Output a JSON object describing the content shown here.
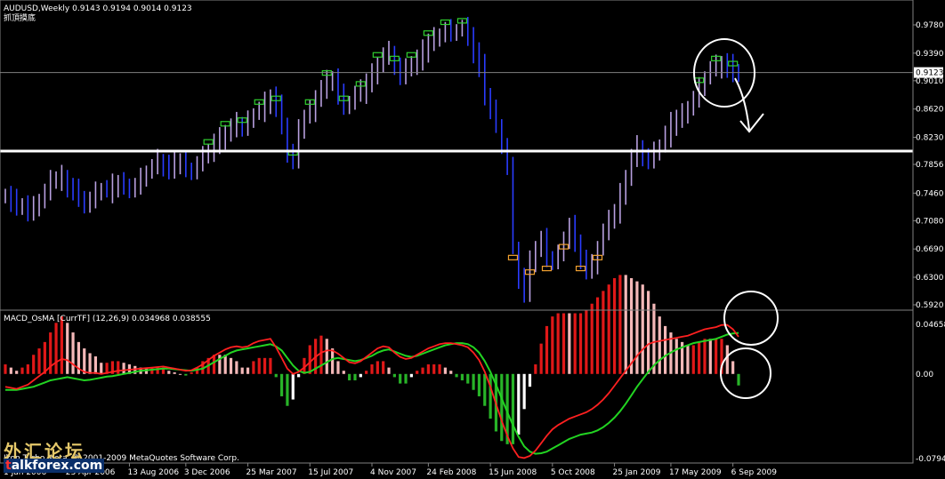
{
  "header": {
    "symbol_line": "AUDUSD,Weekly  0.9143 0.9194 0.9014 0.9123",
    "subtitle": "抓頂摸底"
  },
  "indicator": {
    "label": "MACD_OsMA [CurrTF] (12,26,9) 0.034968 0.038555"
  },
  "footer": {
    "copyright": "Ikon Turbo Meta, © 2001-2009 MetaQuotes Software Corp."
  },
  "watermark": {
    "line1": "外汇论坛",
    "line2_prefix": "t",
    "line2_rest": "alkforex.com"
  },
  "colors": {
    "background": "#000000",
    "grid": "#808080",
    "bull_candle": "#b8a0e0",
    "bear_candle": "#2a3cff",
    "support_line": "#ffffff",
    "macd_line": "#ff2020",
    "signal_line": "#22d422",
    "hist_pos_strong": "#e01818",
    "hist_pos_weak": "#f4b8b8",
    "hist_neg_strong": "#28b428",
    "hist_neg_weak": "#ffffff",
    "marker_buy": "#f0a030",
    "marker_sell": "#30d030",
    "current_price_box": "#ffffff"
  },
  "chart_data": [
    {
      "type": "candlestick",
      "timeframe": "Weekly",
      "ylim": [
        0.592,
        0.978
      ],
      "y_ticks": [
        "0.9780",
        "0.9390",
        "0.9010",
        "0.8620",
        "0.8230",
        "0.7856",
        "0.7460",
        "0.7080",
        "0.6690",
        "0.6300",
        "0.5920"
      ],
      "current_price": "0.9123",
      "support_level": 0.804,
      "x_tick_labels": [
        "1 Jan 2006",
        "23 Apr 2006",
        "13 Aug 2006",
        "3 Dec 2006",
        "25 Mar 2007",
        "15 Jul 2007",
        "4 Nov 2007",
        "24 Feb 2008",
        "15 Jun 2008",
        "5 Oct 2008",
        "25 Jan 2009",
        "17 May 2009",
        "6 Sep 2009"
      ],
      "closes": [
        0.744,
        0.736,
        0.73,
        0.73,
        0.72,
        0.725,
        0.735,
        0.745,
        0.76,
        0.765,
        0.77,
        0.755,
        0.75,
        0.74,
        0.73,
        0.735,
        0.745,
        0.75,
        0.748,
        0.755,
        0.76,
        0.758,
        0.752,
        0.755,
        0.765,
        0.775,
        0.78,
        0.79,
        0.785,
        0.78,
        0.785,
        0.79,
        0.78,
        0.775,
        0.785,
        0.795,
        0.805,
        0.815,
        0.82,
        0.83,
        0.835,
        0.84,
        0.835,
        0.845,
        0.855,
        0.86,
        0.87,
        0.88,
        0.865,
        0.84,
        0.8,
        0.79,
        0.83,
        0.85,
        0.86,
        0.88,
        0.89,
        0.9,
        0.905,
        0.88,
        0.865,
        0.87,
        0.88,
        0.885,
        0.9,
        0.91,
        0.925,
        0.935,
        0.94,
        0.92,
        0.905,
        0.915,
        0.925,
        0.93,
        0.94,
        0.955,
        0.96,
        0.965,
        0.97,
        0.965,
        0.97,
        0.972,
        0.965,
        0.94,
        0.92,
        0.88,
        0.86,
        0.84,
        0.81,
        0.78,
        0.67,
        0.63,
        0.61,
        0.65,
        0.67,
        0.68,
        0.655,
        0.65,
        0.66,
        0.685,
        0.7,
        0.68,
        0.655,
        0.64,
        0.645,
        0.67,
        0.69,
        0.705,
        0.72,
        0.745,
        0.77,
        0.795,
        0.81,
        0.795,
        0.79,
        0.8,
        0.81,
        0.825,
        0.84,
        0.85,
        0.855,
        0.865,
        0.875,
        0.89,
        0.905,
        0.915,
        0.92,
        0.925,
        0.92,
        0.913,
        0.9123
      ]
    },
    {
      "type": "histogram_with_lines",
      "name": "MACD_OsMA [CurrTF] (12,26,9)",
      "ylim": [
        -0.07948,
        0.04658
      ],
      "y_ticks": [
        "0.04658",
        "0.00",
        "-0.07948"
      ],
      "macd_value": 0.034968,
      "signal_value": 0.038555,
      "signal_line": [
        -0.015,
        -0.015,
        -0.015,
        -0.014,
        -0.013,
        -0.012,
        -0.01,
        -0.008,
        -0.006,
        -0.005,
        -0.004,
        -0.003,
        -0.004,
        -0.005,
        -0.006,
        -0.0055,
        -0.0045,
        -0.0035,
        -0.0025,
        -0.002,
        -0.001,
        0.0,
        0.001,
        0.002,
        0.003,
        0.0035,
        0.004,
        0.0045,
        0.005,
        0.005,
        0.0045,
        0.004,
        0.0035,
        0.003,
        0.004,
        0.005,
        0.008,
        0.011,
        0.014,
        0.017,
        0.02,
        0.022,
        0.023,
        0.024,
        0.025,
        0.026,
        0.027,
        0.028,
        0.026,
        0.022,
        0.015,
        0.008,
        0.003,
        0.001,
        0.002,
        0.005,
        0.008,
        0.011,
        0.014,
        0.015,
        0.014,
        0.013,
        0.012,
        0.013,
        0.015,
        0.017,
        0.02,
        0.022,
        0.023,
        0.021,
        0.019,
        0.017,
        0.016,
        0.017,
        0.019,
        0.021,
        0.023,
        0.025,
        0.027,
        0.028,
        0.029,
        0.029,
        0.028,
        0.025,
        0.02,
        0.012,
        0.002,
        -0.01,
        -0.023,
        -0.036,
        -0.048,
        -0.059,
        -0.068,
        -0.073,
        -0.075,
        -0.0745,
        -0.073,
        -0.07,
        -0.067,
        -0.064,
        -0.061,
        -0.059,
        -0.057,
        -0.056,
        -0.055,
        -0.053,
        -0.05,
        -0.046,
        -0.041,
        -0.035,
        -0.028,
        -0.02,
        -0.012,
        -0.005,
        0.002,
        0.008,
        0.013,
        0.017,
        0.02,
        0.023,
        0.025,
        0.027,
        0.029,
        0.03,
        0.031,
        0.032,
        0.033,
        0.035,
        0.037,
        0.038,
        0.0386
      ],
      "macd_line": [
        -0.012,
        -0.013,
        -0.014,
        -0.012,
        -0.01,
        -0.006,
        -0.002,
        0.002,
        0.007,
        0.011,
        0.014,
        0.013,
        0.009,
        0.005,
        0.002,
        0.001,
        0.001,
        0.0,
        0.001,
        0.002,
        0.003,
        0.0035,
        0.004,
        0.0045,
        0.005,
        0.0055,
        0.006,
        0.0065,
        0.007,
        0.006,
        0.005,
        0.004,
        0.003,
        0.0035,
        0.006,
        0.009,
        0.013,
        0.017,
        0.02,
        0.023,
        0.025,
        0.026,
        0.025,
        0.026,
        0.029,
        0.031,
        0.032,
        0.033,
        0.025,
        0.015,
        0.005,
        0.0,
        0.002,
        0.006,
        0.011,
        0.016,
        0.02,
        0.022,
        0.022,
        0.019,
        0.015,
        0.011,
        0.01,
        0.012,
        0.016,
        0.02,
        0.024,
        0.026,
        0.025,
        0.02,
        0.016,
        0.014,
        0.015,
        0.018,
        0.021,
        0.024,
        0.026,
        0.028,
        0.029,
        0.029,
        0.028,
        0.027,
        0.025,
        0.02,
        0.013,
        0.002,
        -0.012,
        -0.028,
        -0.044,
        -0.058,
        -0.07,
        -0.078,
        -0.079,
        -0.077,
        -0.072,
        -0.065,
        -0.058,
        -0.052,
        -0.048,
        -0.045,
        -0.042,
        -0.04,
        -0.038,
        -0.036,
        -0.033,
        -0.029,
        -0.024,
        -0.018,
        -0.011,
        -0.004,
        0.003,
        0.01,
        0.017,
        0.023,
        0.028,
        0.03,
        0.031,
        0.032,
        0.033,
        0.034,
        0.035,
        0.036,
        0.038,
        0.04,
        0.042,
        0.043,
        0.044,
        0.046,
        0.046,
        0.042,
        0.035
      ]
    }
  ]
}
